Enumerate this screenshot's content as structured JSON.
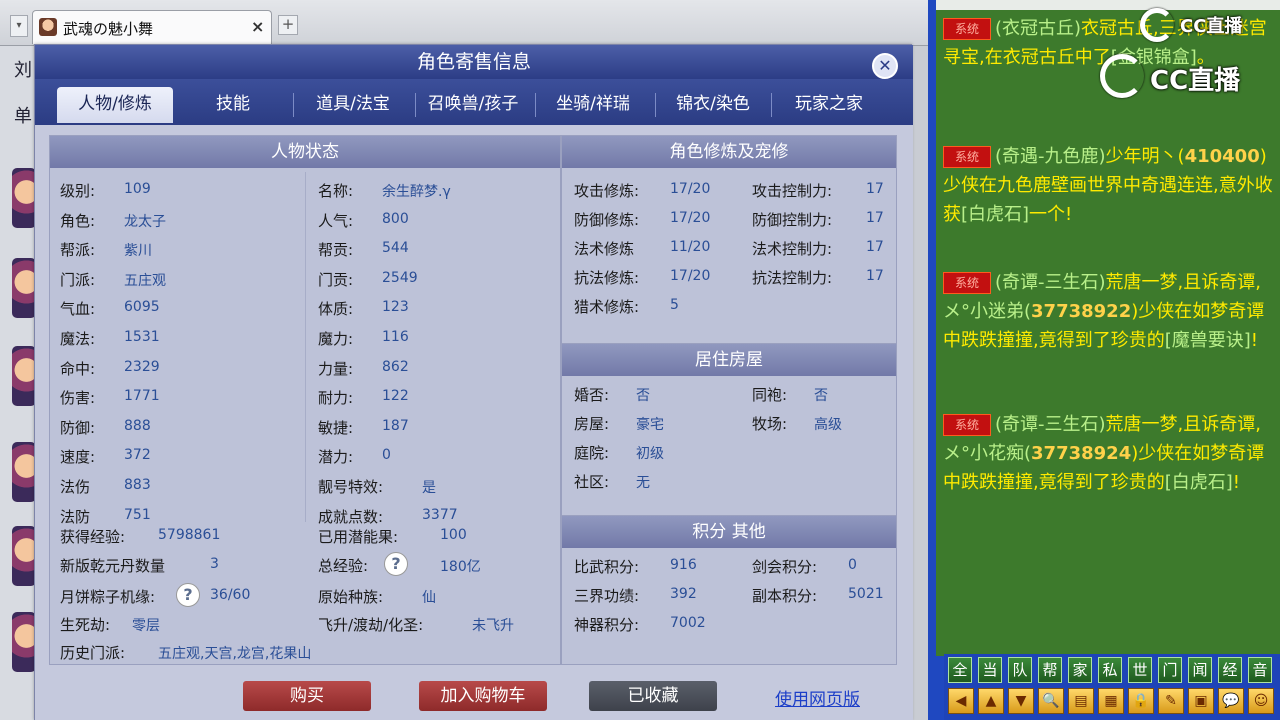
{
  "browser": {
    "tab_title": "武魂の魅小舞",
    "tab_close": "×",
    "tab_add": "+"
  },
  "left_fragments": [
    "刘",
    "单"
  ],
  "dialog": {
    "title": "角色寄售信息",
    "close": "✕"
  },
  "tabs": [
    "人物/修炼",
    "技能",
    "道具/法宝",
    "召唤兽/孩子",
    "坐骑/祥瑞",
    "锦衣/染色",
    "玩家之家"
  ],
  "status": {
    "header": "人物状态",
    "col1": [
      {
        "label": "级别:",
        "value": "109"
      },
      {
        "label": "角色:",
        "value": "龙太子"
      },
      {
        "label": "帮派:",
        "value": "紫川"
      },
      {
        "label": "门派:",
        "value": "五庄观"
      },
      {
        "label": "气血:",
        "value": "6095"
      },
      {
        "label": "魔法:",
        "value": "1531"
      },
      {
        "label": "命中:",
        "value": "2329"
      },
      {
        "label": "伤害:",
        "value": "1771"
      },
      {
        "label": "防御:",
        "value": "888"
      },
      {
        "label": "速度:",
        "value": "372"
      },
      {
        "label": "法伤",
        "value": "883"
      },
      {
        "label": "法防",
        "value": "751"
      }
    ],
    "col2": [
      {
        "label": "名称:",
        "value": "余生醉梦.γ"
      },
      {
        "label": "人气:",
        "value": "800"
      },
      {
        "label": "帮贡:",
        "value": "544"
      },
      {
        "label": "门贡:",
        "value": "2549"
      },
      {
        "label": "体质:",
        "value": "123"
      },
      {
        "label": "魔力:",
        "value": "116"
      },
      {
        "label": "力量:",
        "value": "862"
      },
      {
        "label": "耐力:",
        "value": "122"
      },
      {
        "label": "敏捷:",
        "value": "187"
      },
      {
        "label": "潜力:",
        "value": "0"
      },
      {
        "label": "靓号特效:",
        "value": "是"
      },
      {
        "label": "成就点数:",
        "value": "3377"
      }
    ],
    "exp_label": "获得经验:",
    "exp_value": "5798861",
    "potential_label": "已用潜能果:",
    "potential_value": "100",
    "pill_label": "新版乾元丹数量",
    "pill_value": "3",
    "total_exp_label": "总经验:",
    "total_exp_value": "180亿",
    "zongzi_label": "月饼粽子机缘:",
    "zongzi_value": "36/60",
    "race_label": "原始种族:",
    "race_value": "仙",
    "life_label": "生死劫:",
    "life_value": "零层",
    "fly_label": "飞升/渡劫/化圣:",
    "fly_value": "未飞升",
    "history_label": "历史门派:",
    "history_value": "五庄观,天宫,龙宫,花果山",
    "question": "?"
  },
  "cultivation": {
    "header": "角色修炼及宠修",
    "rows": [
      {
        "l1": "攻击修炼:",
        "v1": "17/20",
        "l2": "攻击控制力:",
        "v2": "17"
      },
      {
        "l1": "防御修炼:",
        "v1": "17/20",
        "l2": "防御控制力:",
        "v2": "17"
      },
      {
        "l1": "法术修炼",
        "v1": "11/20",
        "l2": "法术控制力:",
        "v2": "17"
      },
      {
        "l1": "抗法修炼:",
        "v1": "17/20",
        "l2": "抗法控制力:",
        "v2": "17"
      },
      {
        "l1": "猎术修炼:",
        "v1": "5",
        "l2": "",
        "v2": ""
      }
    ]
  },
  "housing": {
    "header": "居住房屋",
    "rows": [
      {
        "l1": "婚否:",
        "v1": "否",
        "l2": "同袍:",
        "v2": "否"
      },
      {
        "l1": "房屋:",
        "v1": "豪宅",
        "l2": "牧场:",
        "v2": "高级"
      },
      {
        "l1": "庭院:",
        "v1": "初级",
        "l2": "",
        "v2": ""
      },
      {
        "l1": "社区:",
        "v1": "无",
        "l2": "",
        "v2": ""
      }
    ]
  },
  "points": {
    "header": "积分 其他",
    "rows": [
      {
        "l1": "比武积分:",
        "v1": "916",
        "l2": "剑会积分:",
        "v2": "0"
      },
      {
        "l1": "三界功绩:",
        "v1": "392",
        "l2": "副本积分:",
        "v2": "5021"
      },
      {
        "l1": "神器积分:",
        "v1": "7002",
        "l2": "",
        "v2": ""
      }
    ]
  },
  "footer": {
    "buy": "购买",
    "cart": "加入购物车",
    "favorited": "已收藏",
    "web": "使用网页版"
  },
  "chat": {
    "sys_tag": "系统",
    "messages": [
      {
        "loc": "(衣冠古丘)",
        "text": "衣冠古丘",
        "rest": ",三界侠士迷宫寻宝,",
        "rest2": "在衣冠古丘中",
        "tail": "了",
        "item": "[金银锦盒]",
        "end": "。"
      },
      {
        "loc": "(奇遇-九色鹿)",
        "name": "少年明丶(",
        "num": "410400",
        "rest": ")少侠在九色鹿壁画世界中奇遇连连,意外收获",
        "item": "[白虎石]",
        "end": "一个!"
      },
      {
        "loc": "(奇谭-三生石)",
        "text": "荒唐一梦,且诉奇谭,",
        "name": "メ°小迷弟(",
        "num": "37738922",
        "rest": ")少侠在如梦奇谭中跌跌撞撞,竟得到了珍贵的",
        "item": "[魔兽要诀]",
        "end": "!"
      },
      {
        "loc": "(奇谭-三生石)",
        "text": "荒唐一梦,且诉奇谭,",
        "name": "メ°小花痴(",
        "num": "37738924",
        "rest": ")少侠在如梦奇谭中跌跌撞撞,竟得到了珍贵的",
        "item": "[白虎石]",
        "end": "!"
      }
    ],
    "watermark": "CC直播",
    "buttons": [
      "全",
      "当",
      "队",
      "帮",
      "家",
      "私",
      "世",
      "门",
      "闻",
      "经",
      "音"
    ],
    "icons": [
      "◀",
      "▲",
      "▼",
      "🔍",
      "▤",
      "▦",
      "🔒",
      "✎",
      "▣",
      "💬",
      "☺"
    ]
  }
}
